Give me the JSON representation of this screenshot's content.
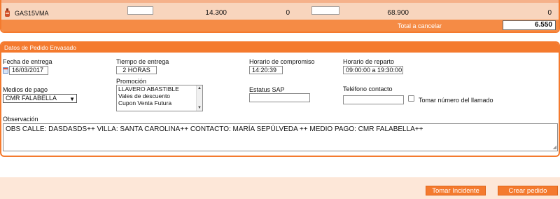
{
  "product": {
    "code": "GAS15VMA",
    "col1": "14.300",
    "col2": "0",
    "col3": "68.900",
    "col4": "0"
  },
  "total": {
    "label": "Total a cancelar",
    "value": "6.550"
  },
  "order": {
    "section_title": "Datos de Pedido Envasado",
    "delivery_date_label": "Fecha de entrega",
    "delivery_date_value": "16/03/2017",
    "delivery_time_label": "Tiempo de entrega",
    "delivery_time_value": "2 HORAS",
    "commitment_label": "Horario de compromiso",
    "commitment_value": "14:20:39",
    "schedule_label": "Horario de reparto",
    "schedule_value": "09:00:00 a 19:30:00",
    "payment_label": "Medios de pago",
    "payment_value": "CMR FALABELLA",
    "promo_label": "Promoción",
    "promo_options": [
      "LLAVERO ABASTIBLE",
      "Vales de descuento",
      "Cupon Venta Futura"
    ],
    "sap_label": "Estatus SAP",
    "sap_value": "",
    "phone_label": "Teléfono contacto",
    "phone_value": "",
    "take_phone_label": "Tomar número del llamado",
    "obs_label": "Observación",
    "obs_value": "OBS CALLE: DASDASDS++ VILLA: SANTA CAROLINA++ CONTACTO: MARÍA SEPÚLVEDA ++ MEDIO PAGO: CMR FALABELLA++"
  },
  "buttons": {
    "incident": "Tomar Incidente",
    "create": "Crear pedido"
  },
  "colors": {
    "accent": "#f47a2e",
    "row_bg": "#f8d5bd",
    "footer_bg": "#fde7d8"
  }
}
